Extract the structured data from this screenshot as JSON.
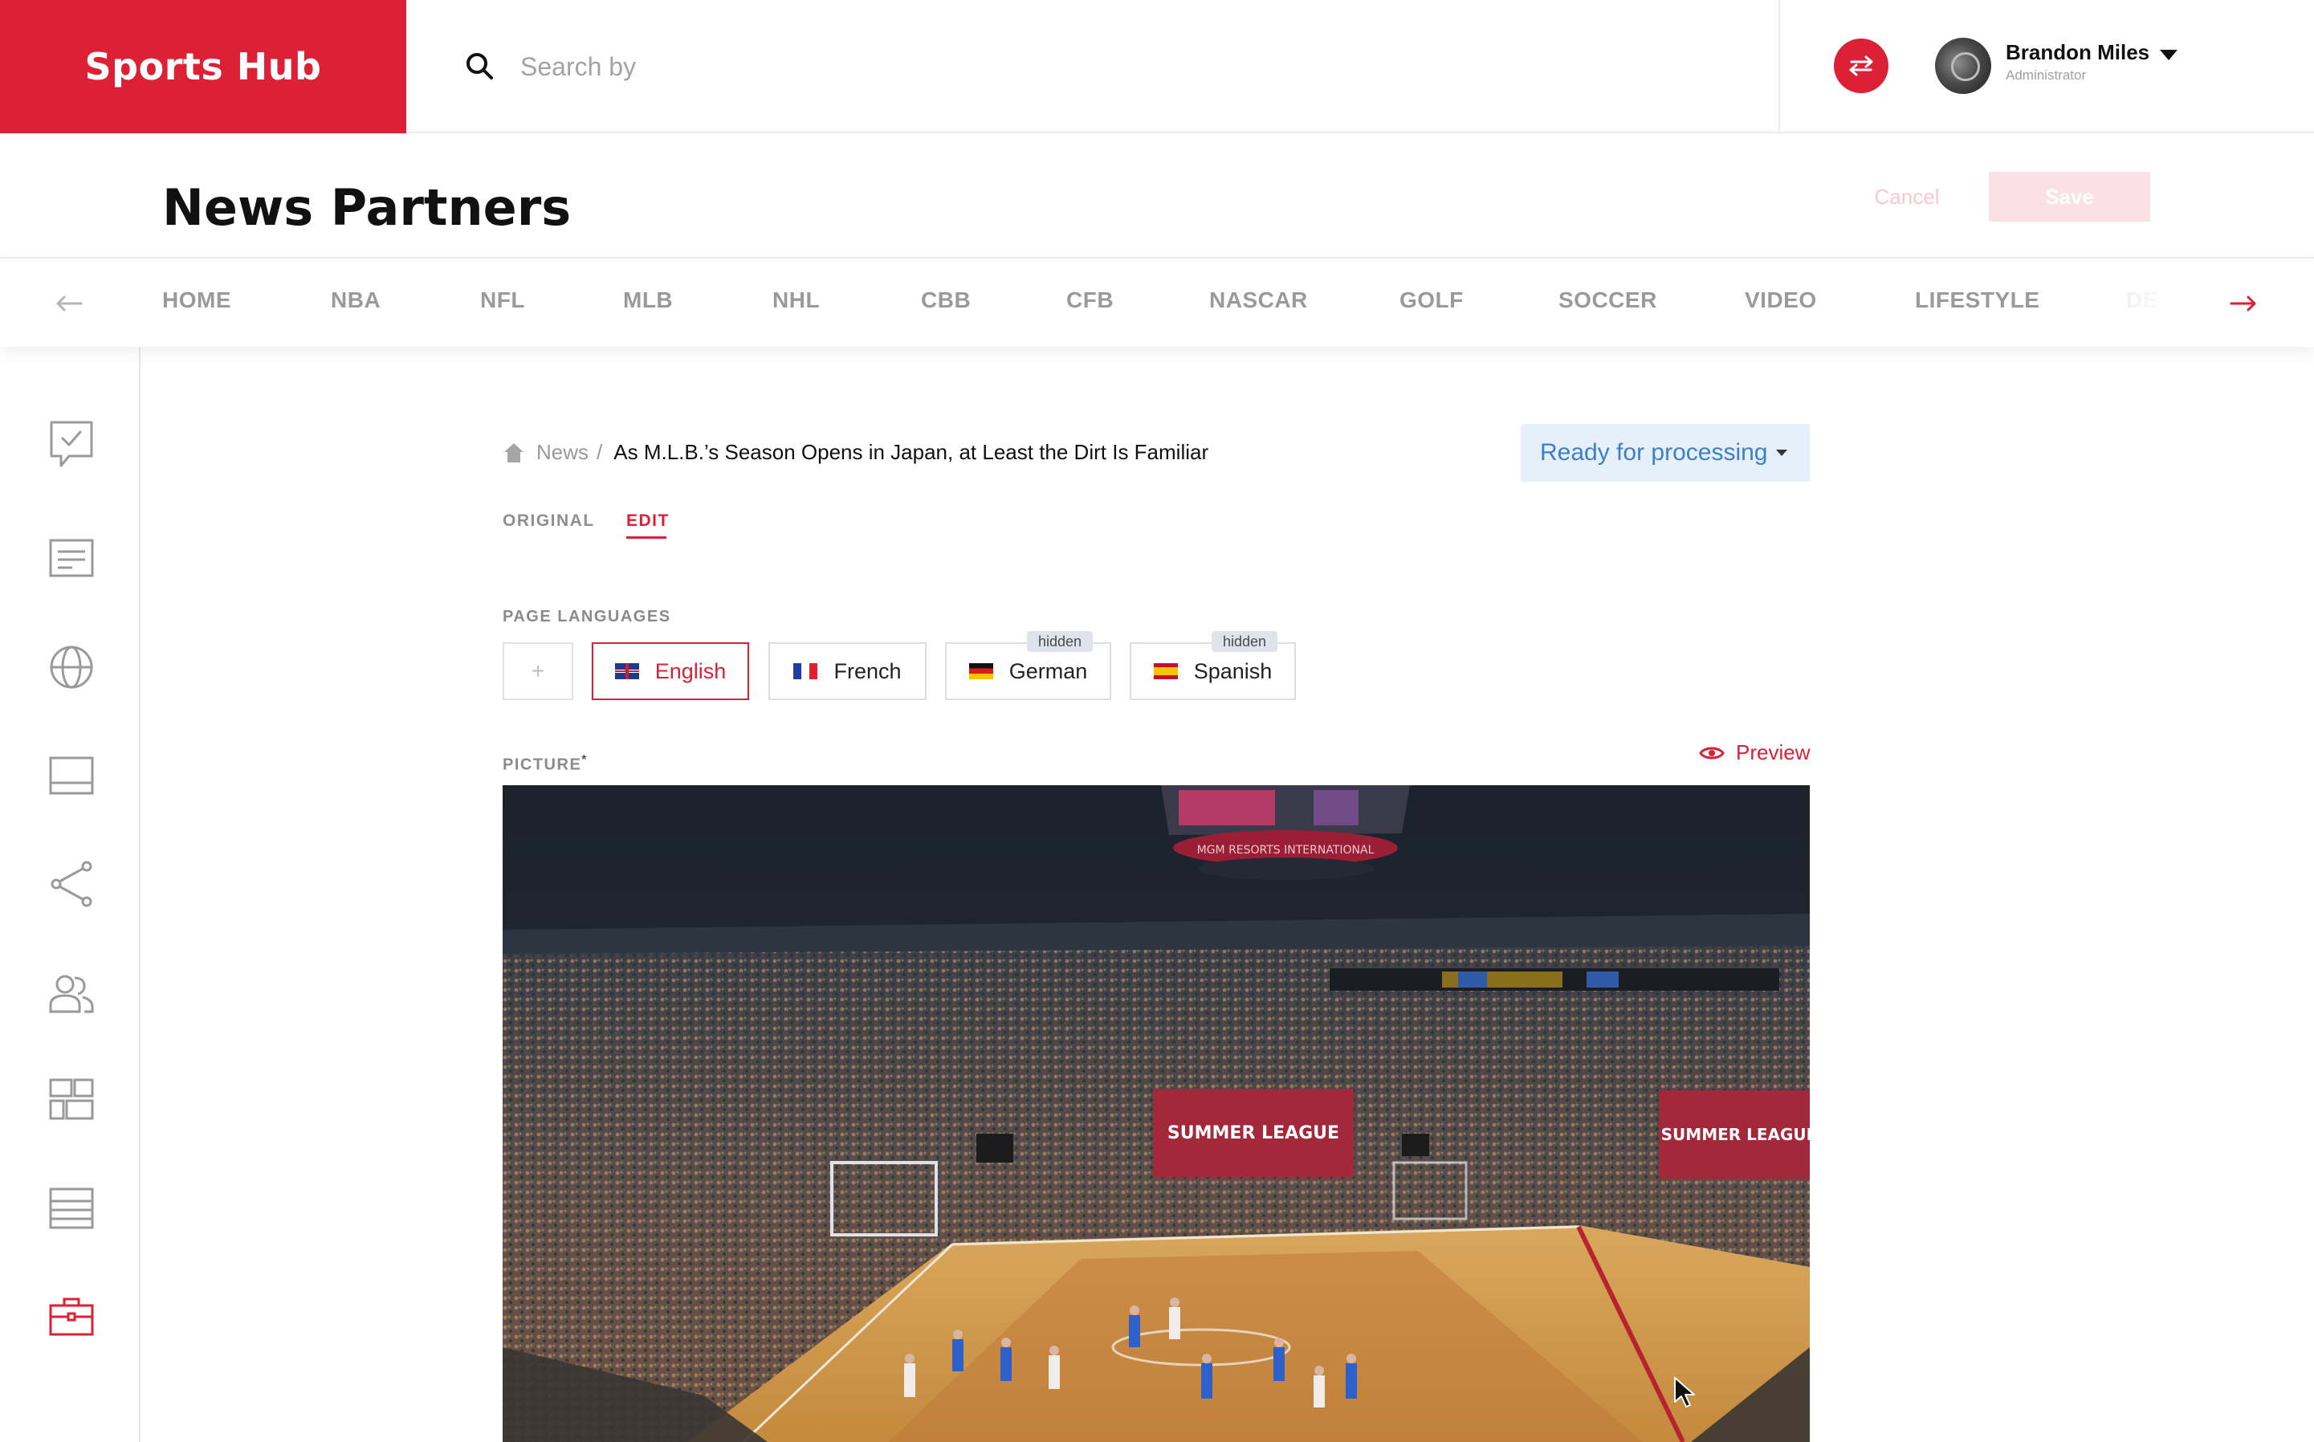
{
  "header": {
    "brand": "Sports Hub",
    "search_placeholder": "Search by",
    "user_name": "Brandon Miles",
    "user_role": "Administrator",
    "brand_color": "#dc2136"
  },
  "page": {
    "title": "News Partners",
    "cancel_label": "Cancel",
    "save_label": "Save"
  },
  "categories": [
    "HOME",
    "NBA",
    "NFL",
    "MLB",
    "NHL",
    "CBB",
    "CFB",
    "NASCAR",
    "GOLF",
    "SOCCER",
    "VIDEO",
    "LIFESTYLE",
    "DE"
  ],
  "sidebar": {
    "icons": [
      "survey-check-icon",
      "articles-icon",
      "globe-icon",
      "banner-icon",
      "share-icon",
      "users-icon",
      "layout-icon",
      "footer-icon",
      "partners-briefcase-icon"
    ],
    "active": "partners-briefcase-icon"
  },
  "breadcrumb": {
    "parent": "News",
    "separator": "/",
    "current": "As M.L.B.’s Season Opens in Japan, at Least the Dirt Is Familiar"
  },
  "status": {
    "value": "Ready for processing"
  },
  "tabs": {
    "original": "ORIGINAL",
    "edit": "EDIT",
    "active": "EDIT"
  },
  "languages": {
    "section_label": "PAGE LANGUAGES",
    "add_label": "+",
    "items": [
      {
        "label": "English",
        "active": true,
        "hidden": false
      },
      {
        "label": "French",
        "active": false,
        "hidden": false
      },
      {
        "label": "German",
        "active": false,
        "hidden": true
      },
      {
        "label": "Spanish",
        "active": false,
        "hidden": true
      }
    ],
    "hidden_badge": "hidden"
  },
  "picture": {
    "section_label": "PICTURE",
    "required_mark": "*",
    "preview_label": "Preview",
    "banner_left": "SUMMER LEAGUE",
    "banner_right": "SUMMER LEAGUE",
    "arena_ring_text": "MGM RESORTS INTERNATIONAL"
  }
}
